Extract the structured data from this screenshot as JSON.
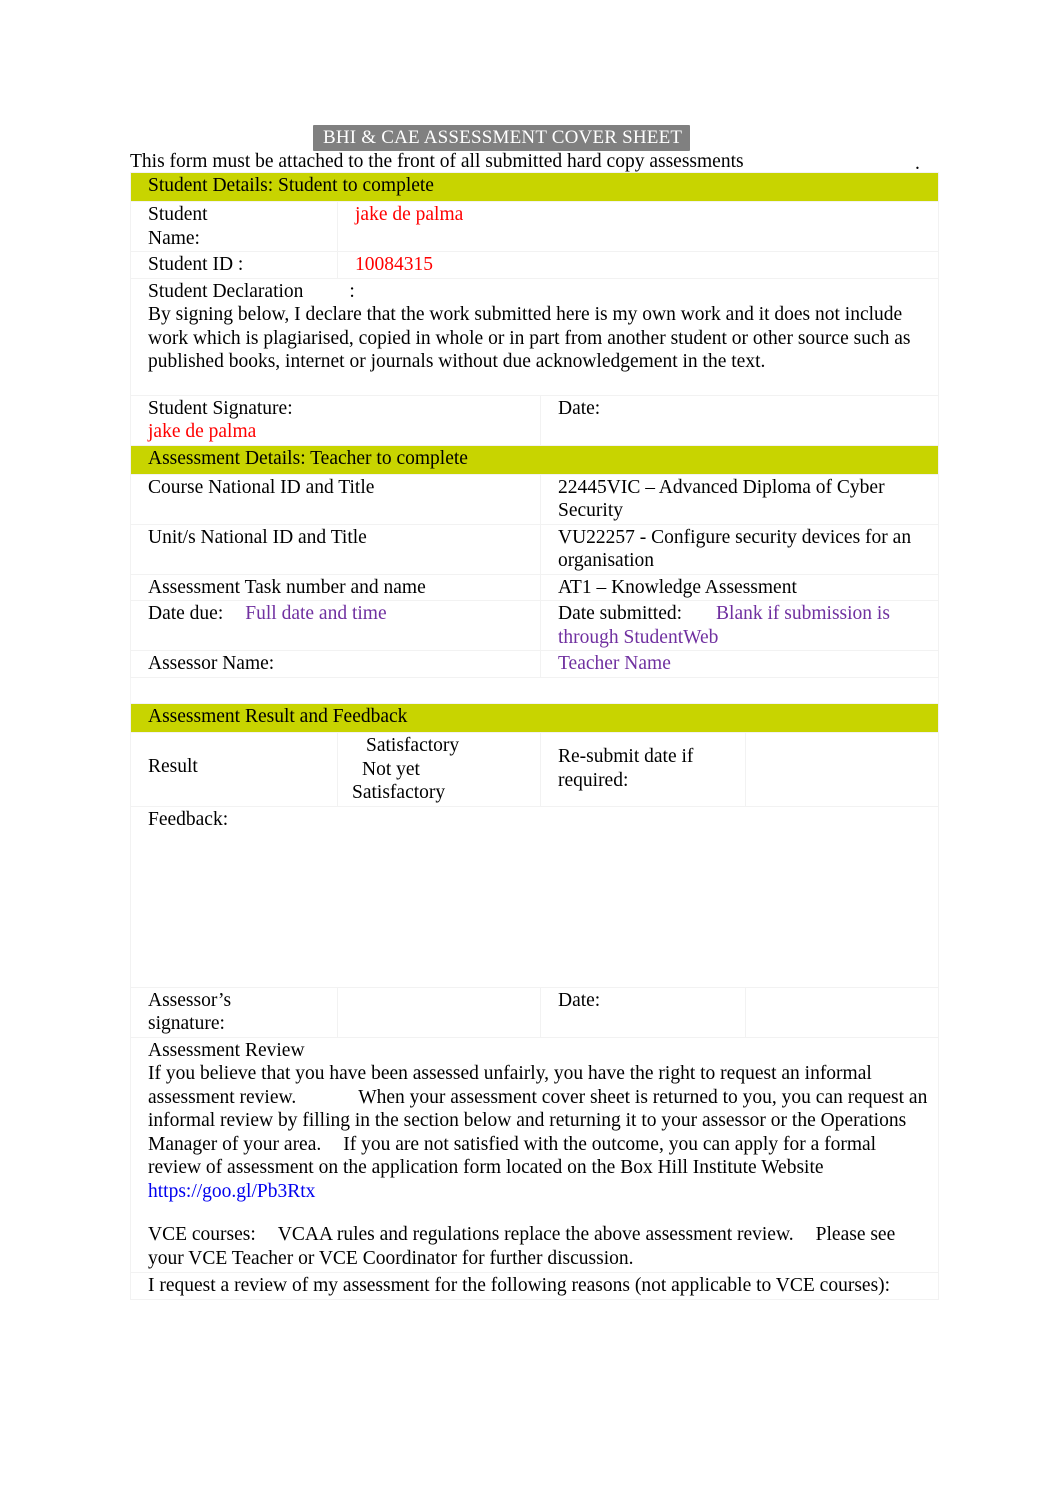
{
  "document": {
    "title_banner": "BHI & CAE ASSESSMENT COVER SHEET",
    "subtitle": "This form must be attached to the front of all submitted hard copy assessments",
    "trailing_dot": "."
  },
  "student_section": {
    "heading": "Student Details: Student to complete",
    "name_label": "Student Name:",
    "name_label_line1": "Student",
    "name_label_line2": "Name:",
    "name_value": "jake de palma",
    "id_label": "Student ID :",
    "id_value": "10084315",
    "declaration_label": "Student Declaration",
    "declaration_colon": ":",
    "declaration_text": "By signing below, I declare that the work submitted here is my own work and it does not include work which is plagiarised, copied in whole or in part from another student or other source such as published books, internet or journals without due acknowledgement in the text.",
    "signature_label": "Student Signature:",
    "signature_value": "jake de palma",
    "date_label": "Date:",
    "date_value": ""
  },
  "assessment_details": {
    "heading": "Assessment Details: Teacher to complete",
    "course_label": "Course National ID and Title",
    "course_value": "22445VIC – Advanced Diploma of Cyber Security",
    "unit_label": "Unit/s National ID and Title",
    "unit_value": "VU22257 - Configure security devices for an organisation",
    "task_label": "Assessment Task number and name",
    "task_value": "AT1 – Knowledge Assessment",
    "date_due_label": "Date due:",
    "date_due_value": "Full date and time",
    "date_submitted_label": "Date submitted:",
    "date_submitted_value": "Blank if submission is through StudentWeb",
    "assessor_name_label": "Assessor Name:",
    "assessor_name_value": "Teacher Name"
  },
  "result_section": {
    "heading": "Assessment Result and Feedback",
    "result_label": "Result",
    "option_satisfactory": "Satisfactory",
    "option_not_yet_line1": "Not yet",
    "option_not_yet_line2": "Satisfactory",
    "resubmit_label": "Re-submit date if required:",
    "resubmit_value": "",
    "result_extra_value": "",
    "feedback_label": "Feedback:",
    "feedback_value": "",
    "assessor_signature_label": "Assessor’s signature:",
    "assessor_signature_value": "",
    "assessor_date_label": "Date:",
    "assessor_date_value": "",
    "assessor_date_extra": ""
  },
  "review_section": {
    "heading": "Assessment Review",
    "para1_a": "If you believe that you have been assessed unfairly, you have the right to request an informal assessment review.",
    "para1_b": "When your assessment cover sheet is returned to you, you can request an informal review by filling in the section below and returning it to your assessor or the Operations Manager of your area.",
    "para1_c": "If you are not satisfied with the outcome, you can apply for a formal review of assessment on the application form located on the Box Hill Institute Website",
    "website_url": "https://goo.gl/Pb3Rtx",
    "vce_label": "VCE courses:",
    "vce_text_a": "VCAA rules and regulations replace the above assessment review.",
    "vce_text_b": "Please see your VCE Teacher or VCE Coordinator for further discussion.",
    "request_text": "I request a review of my assessment for the following reasons (not applicable to VCE courses):",
    "request_value": ""
  },
  "colors": {
    "green_highlight": "#c8d400",
    "gray_banner": "#808080",
    "red_text": "#ff0000",
    "purple_text": "#7030a0",
    "link_blue": "#0000ee"
  }
}
